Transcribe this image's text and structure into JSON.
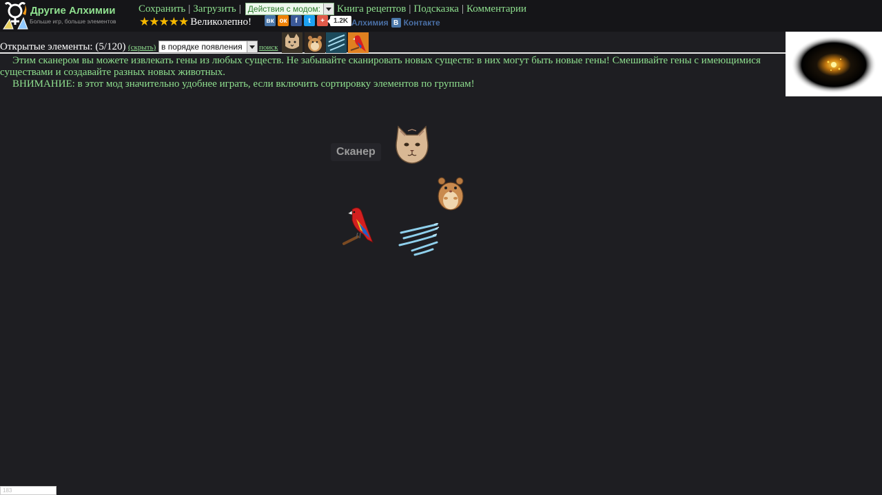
{
  "header": {
    "title": "Другие Алхимии",
    "subtitle": "Больше игр, больше элементов",
    "nav": {
      "save": "Сохранить",
      "load": "Загрузить",
      "mod_actions": "Действия с модом:",
      "recipes": "Книга рецептов",
      "hint": "Подсказка",
      "comments": "Комментарии",
      "separator": "|"
    },
    "rating": {
      "stars": 5,
      "text": "Великолепно!"
    },
    "share": {
      "buttons": [
        {
          "icon": "vk-icon",
          "glyph": "вк",
          "color": "#4a76a8"
        },
        {
          "icon": "odnoklassniki-icon",
          "glyph": "ок",
          "color": "#ee8208"
        },
        {
          "icon": "facebook-icon",
          "glyph": "f",
          "color": "#3b5998"
        },
        {
          "icon": "twitter-icon",
          "glyph": "t",
          "color": "#1da1f2"
        },
        {
          "icon": "plus-icon",
          "glyph": "+",
          "color": "#e05a4a"
        }
      ],
      "count": "1.2K"
    },
    "vk_group": {
      "name": "Алхимия",
      "badge": "В",
      "suffix": "Контакте"
    }
  },
  "elements_bar": {
    "label": "Открытые элементы: (5/120)",
    "hide": "(скрыть)",
    "sort_value": "в порядке появления",
    "search": "поиск",
    "items": [
      "cat-icon",
      "hamster-icon",
      "fish-icon",
      "parrot-icon"
    ]
  },
  "description": {
    "line1": "Этим сканером вы можете извлекать гены из любых существ. Не забывайте сканировать новых существ: в них могут быть новые гены! Смешивайте гены с имеющимися существами и создавайте разных новых животных.",
    "line2": "ВНИМАНИЕ: в этот мод значительно удобнее играть, если включить сортировку элементов по группам!"
  },
  "workspace": {
    "scanner": "Сканер",
    "creatures": [
      "cat-icon",
      "hamster-icon",
      "parrot-icon",
      "fish-icon"
    ]
  },
  "footer": {
    "counter": "183"
  },
  "colors": {
    "background": "#1e1e22",
    "link_green": "#8fe08f",
    "star": "#f5b800"
  }
}
